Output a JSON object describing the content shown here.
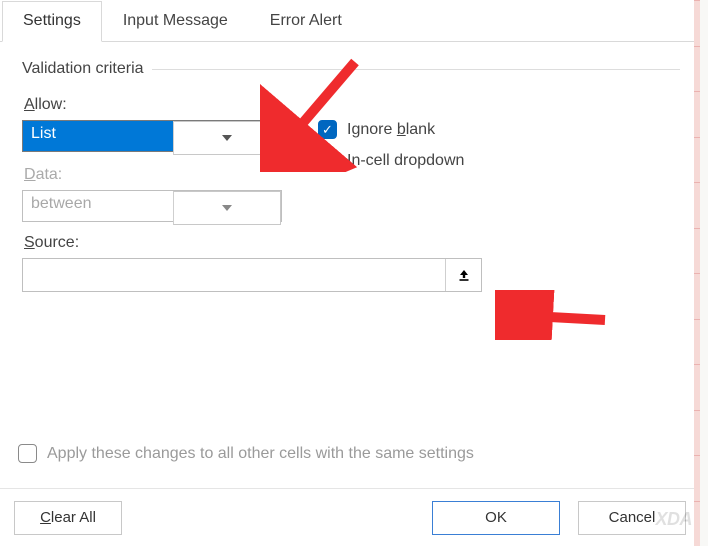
{
  "tabs": [
    {
      "label": "Settings",
      "active": true
    },
    {
      "label": "Input Message",
      "active": false
    },
    {
      "label": "Error Alert",
      "active": false
    }
  ],
  "section_title": "Validation criteria",
  "allow": {
    "label": "Allow:",
    "underline_char": "A",
    "value": "List"
  },
  "data": {
    "label": "Data:",
    "underline_char": "D",
    "value": "between"
  },
  "ignore_blank": {
    "label": "Ignore blank",
    "underline_prefix": "Ignore ",
    "underline_char": "b",
    "underline_suffix": "lank",
    "checked": true
  },
  "incell": {
    "label": "In-cell dropdown",
    "underline_prefix": "",
    "underline_char": "I",
    "underline_suffix": "n-cell dropdown",
    "checked": true
  },
  "source": {
    "label": "Source:",
    "underline_char": "S",
    "value": ""
  },
  "apply": {
    "label": "Apply these changes to all other cells with the same settings",
    "underline_char": "P",
    "checked": false
  },
  "footer": {
    "clear_all": "Clear All",
    "clear_all_under": "C",
    "ok": "OK",
    "cancel": "Cancel"
  },
  "watermark": "XDA"
}
